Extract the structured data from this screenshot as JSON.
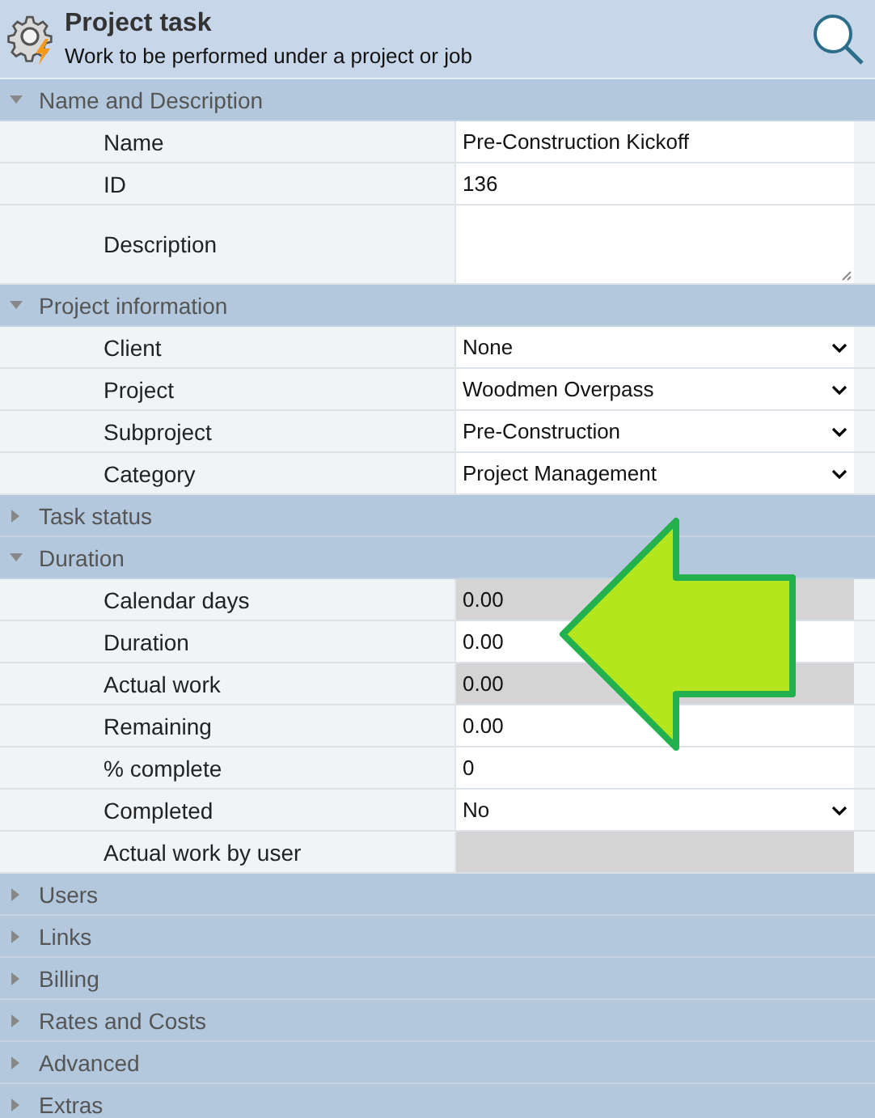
{
  "header": {
    "title": "Project task",
    "subtitle": "Work to be performed under a project or job"
  },
  "sections": [
    {
      "title": "Name and Description",
      "expanded": true,
      "fields": [
        {
          "label": "Name",
          "kind": "text",
          "value": "Pre-Construction Kickoff"
        },
        {
          "label": "ID",
          "kind": "text",
          "value": "136"
        },
        {
          "label": "Description",
          "kind": "textarea"
        }
      ]
    },
    {
      "title": "Project information",
      "expanded": true,
      "fields": [
        {
          "label": "Client",
          "kind": "select",
          "value": "None"
        },
        {
          "label": "Project",
          "kind": "select",
          "value": "Woodmen Overpass"
        },
        {
          "label": "Subproject",
          "kind": "select",
          "value": "Pre-Construction"
        },
        {
          "label": "Category",
          "kind": "select",
          "value": "Project Management"
        }
      ]
    },
    {
      "title": "Task status",
      "expanded": false
    },
    {
      "title": "Duration",
      "expanded": true,
      "fields": [
        {
          "label": "Calendar days",
          "kind": "readonly",
          "value": "0.00"
        },
        {
          "label": "Duration",
          "kind": "text",
          "value": "0.00"
        },
        {
          "label": "Actual work",
          "kind": "readonly",
          "value": "0.00"
        },
        {
          "label": "Remaining",
          "kind": "text",
          "value": "0.00"
        },
        {
          "label": "% complete",
          "kind": "text",
          "value": "0"
        },
        {
          "label": "Completed",
          "kind": "select",
          "value": "No"
        },
        {
          "label": "Actual work by user",
          "kind": "readonly"
        }
      ]
    },
    {
      "title": "Users",
      "expanded": false
    },
    {
      "title": "Links",
      "expanded": false
    },
    {
      "title": "Billing",
      "expanded": false
    },
    {
      "title": "Rates and Costs",
      "expanded": false
    },
    {
      "title": "Advanced",
      "expanded": false
    },
    {
      "title": "Extras",
      "expanded": false
    }
  ]
}
